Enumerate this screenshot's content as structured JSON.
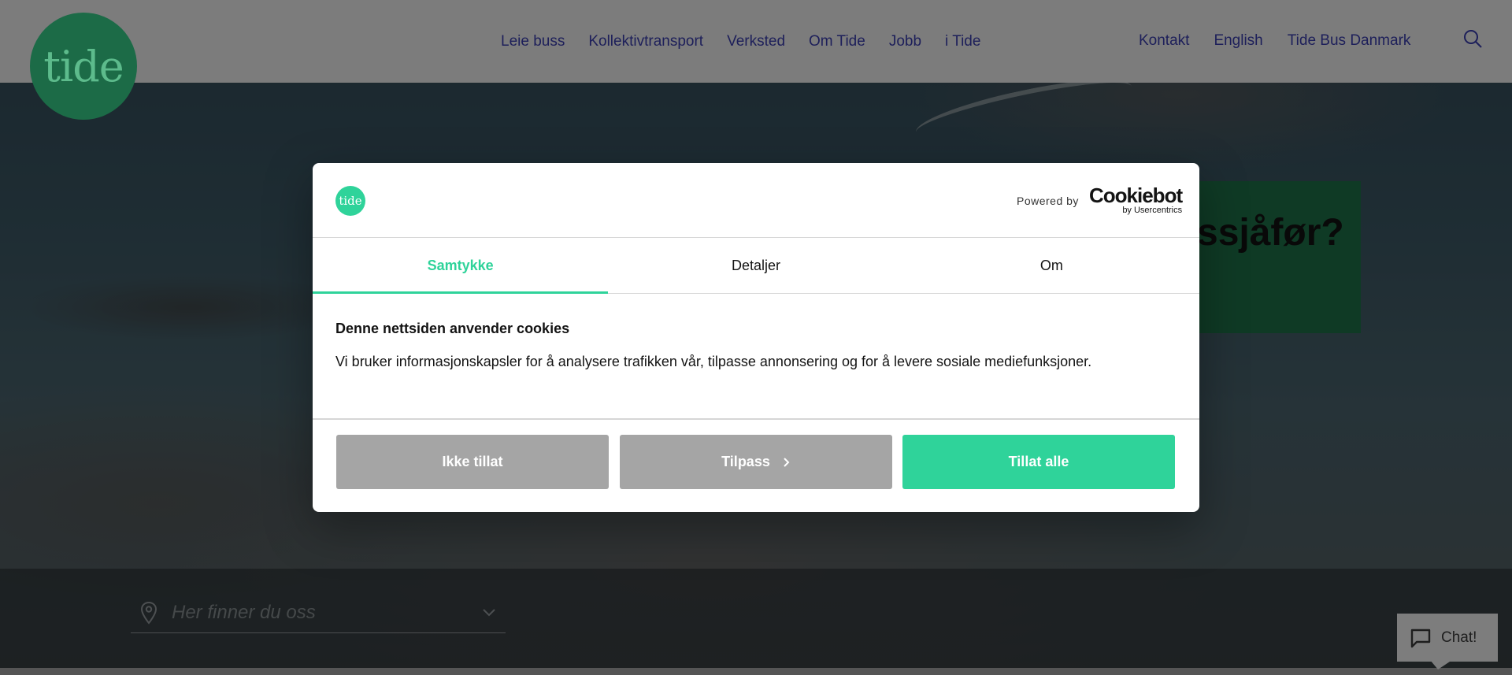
{
  "header": {
    "logo_text": "tide",
    "nav_main": [
      "Leie buss",
      "Kollektivtransport",
      "Verksted",
      "Om Tide",
      "Jobb",
      "i Tide"
    ],
    "nav_right": [
      "Kontakt",
      "English",
      "Tide Bus Danmark"
    ]
  },
  "hero": {
    "promo_text": "ssjåfør?"
  },
  "location": {
    "placeholder": "Her finner du oss"
  },
  "chat": {
    "label": "Chat!"
  },
  "cookie_dialog": {
    "logo_text": "tide",
    "powered_by": "Powered by",
    "brand_name": "Cookiebot",
    "brand_sub": "by Usercentrics",
    "tabs": [
      {
        "label": "Samtykke",
        "active": true
      },
      {
        "label": "Detaljer",
        "active": false
      },
      {
        "label": "Om",
        "active": false
      }
    ],
    "heading": "Denne nettsiden anvender cookies",
    "body": "Vi bruker informasjonskapsler for å analysere trafikken vår, tilpasse annonsering og for å levere sosiale mediefunksjoner.",
    "buttons": {
      "deny": "Ikke tillat",
      "customize": "Tilpass",
      "allow": "Tillat alle"
    }
  },
  "colors": {
    "accent": "#2fd39a",
    "brand_green": "#1c6b47",
    "nav_text": "#1d1f5a",
    "button_grey": "#a5a5a5"
  }
}
